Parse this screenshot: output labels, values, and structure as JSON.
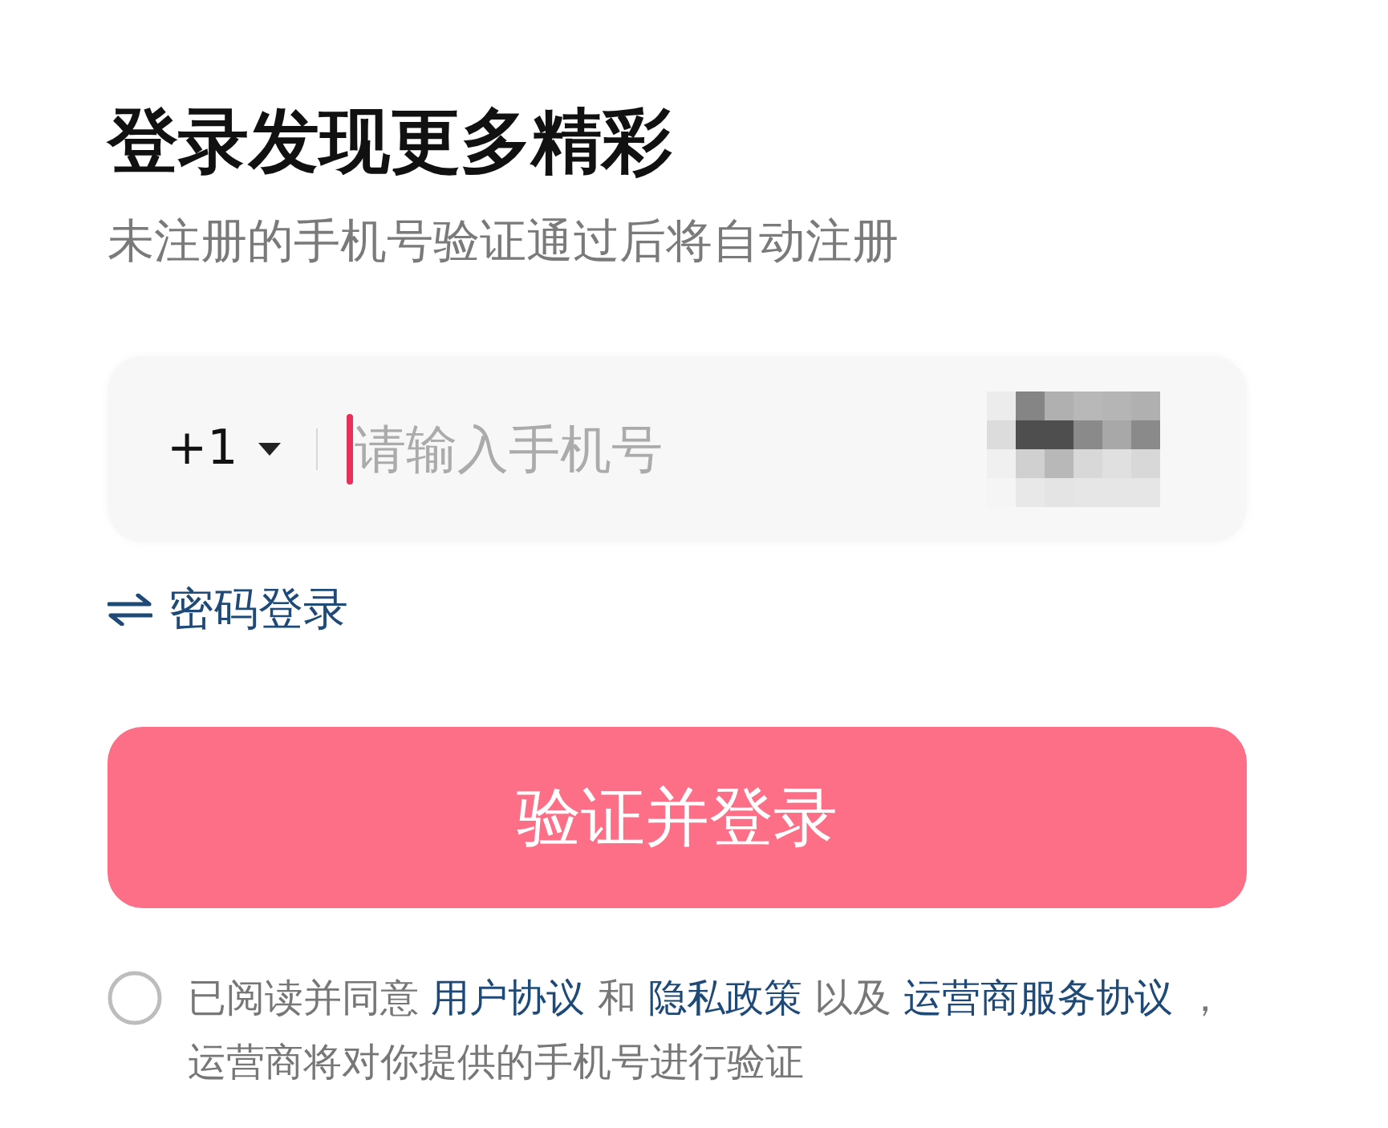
{
  "heading": {
    "title": "登录发现更多精彩",
    "subtitle": "未注册的手机号验证通过后将自动注册"
  },
  "phone_input": {
    "country_code": "+1",
    "placeholder": "请输入手机号",
    "focused": true
  },
  "switch_link": {
    "label": "密码登录"
  },
  "submit_button": {
    "label": "验证并登录"
  },
  "agreement": {
    "checked": false,
    "segments": [
      {
        "kind": "text",
        "text": "已阅读并同意 "
      },
      {
        "kind": "link",
        "text": "用户协议"
      },
      {
        "kind": "text",
        "text": " 和 "
      },
      {
        "kind": "link",
        "text": "隐私政策"
      },
      {
        "kind": "text",
        "text": " 以及 "
      },
      {
        "kind": "link",
        "text": "运营商服务协议"
      },
      {
        "kind": "text",
        "text": " ，运营商将对你提供的手机号进行验证"
      }
    ]
  }
}
